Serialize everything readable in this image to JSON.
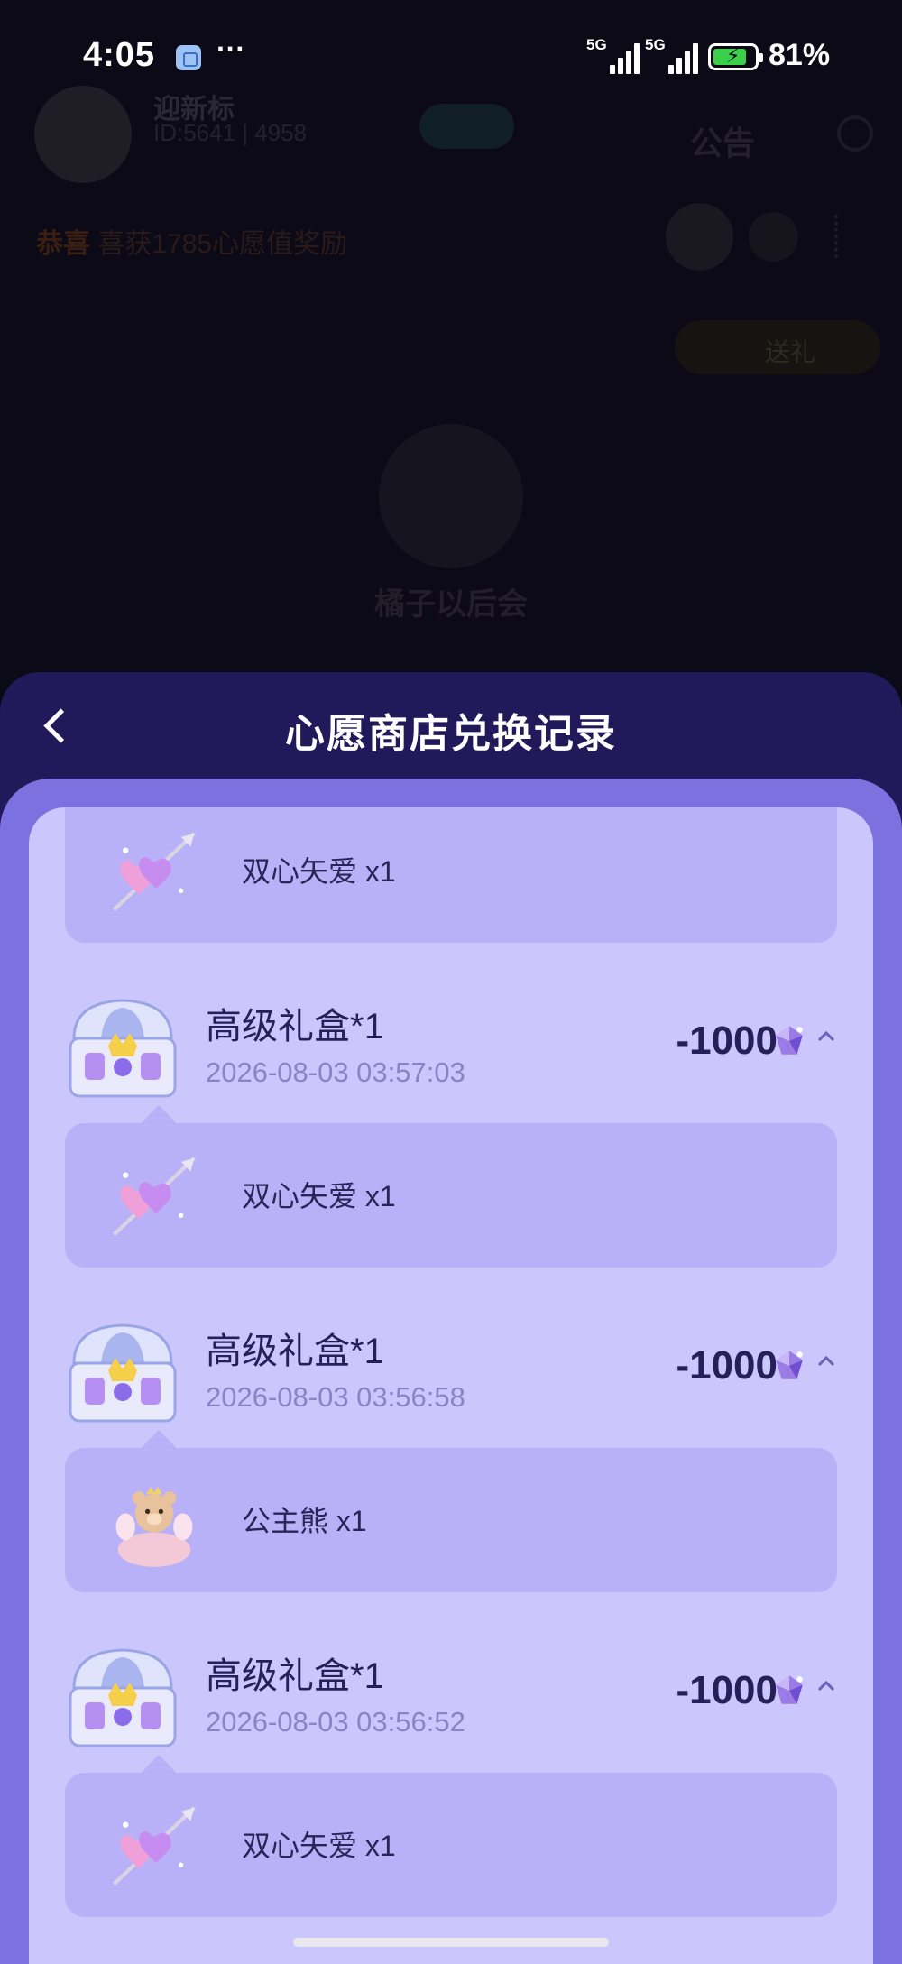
{
  "status_bar": {
    "time": "4:05",
    "more": "···",
    "network_1": "5G",
    "network_2": "5G",
    "battery_percent": "81%",
    "battery_level": 0.81,
    "battery_charging": true
  },
  "background_room": {
    "room_name": "迎新标",
    "room_sub": "ID:5641 | 4958",
    "room_sub2": "",
    "notice_label": "公告",
    "marquee_prefix": "恭喜",
    "marquee_text": "喜获1785心愿值奖励",
    "badge_text": "送礼",
    "host_name": "橘子以后会"
  },
  "sheet": {
    "title": "心愿商店兑换记录",
    "accent_color": "#7d71df",
    "header_color": "#22195a"
  },
  "rewards": [
    {
      "label": "双心矢爱 x1",
      "icon": "double-heart-arrow-icon"
    },
    {
      "label": "双心矢爱 x1",
      "icon": "double-heart-arrow-icon"
    },
    {
      "label": "公主熊 x1",
      "icon": "princess-bear-icon"
    },
    {
      "label": "双心矢爱 x1",
      "icon": "double-heart-arrow-icon"
    }
  ],
  "records": [
    {
      "title": "高级礼盒*1",
      "date": "2026-08-03 03:57:03",
      "amount": "-1000",
      "icon": "treasure-chest-icon",
      "currency_icon": "purple-gem-icon",
      "expanded": true
    },
    {
      "title": "高级礼盒*1",
      "date": "2026-08-03 03:56:58",
      "amount": "-1000",
      "icon": "treasure-chest-icon",
      "currency_icon": "purple-gem-icon",
      "expanded": true
    },
    {
      "title": "高级礼盒*1",
      "date": "2026-08-03 03:56:52",
      "amount": "-1000",
      "icon": "treasure-chest-icon",
      "currency_icon": "purple-gem-icon",
      "expanded": true
    }
  ]
}
